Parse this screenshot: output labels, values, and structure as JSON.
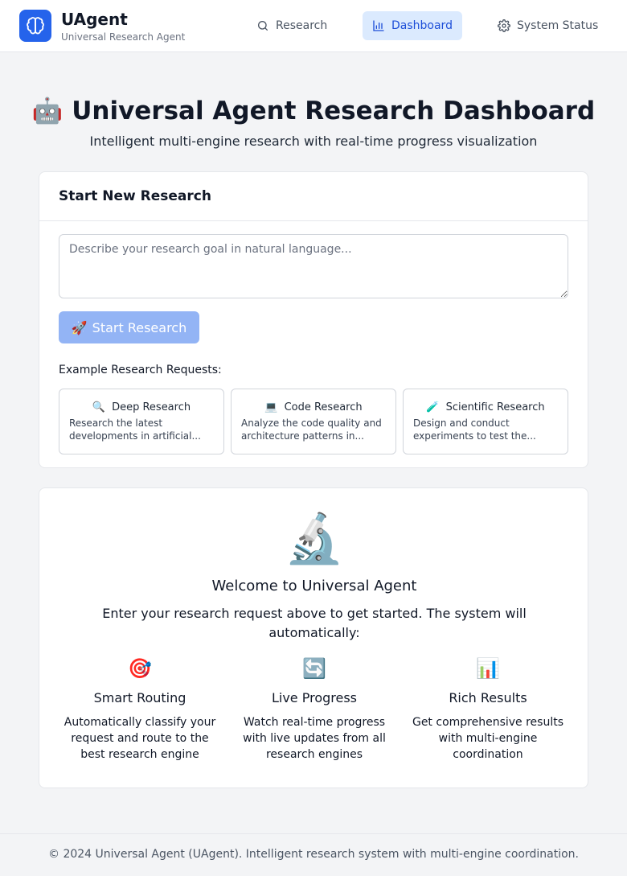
{
  "header": {
    "app_name": "UAgent",
    "app_subtitle": "Universal Research Agent",
    "logo_icon": "brain-icon",
    "nav": [
      {
        "label": "Research",
        "icon": "search-icon",
        "active": false
      },
      {
        "label": "Dashboard",
        "icon": "bar-chart-icon",
        "active": true
      },
      {
        "label": "System Status",
        "icon": "gear-icon",
        "active": false
      }
    ]
  },
  "page": {
    "title_emoji": "🤖",
    "title": "Universal Agent Research Dashboard",
    "subtitle": "Intelligent multi-engine research with real-time progress visualization"
  },
  "research_form": {
    "heading": "Start New Research",
    "goal_placeholder": "Describe your research goal in natural language...",
    "goal_value": "",
    "start_button_emoji": "🚀",
    "start_button_label": "Start Research",
    "examples_label": "Example Research Requests:",
    "examples": [
      {
        "emoji": "🔍",
        "title": "Deep Research",
        "description": "Research the latest developments in artificial..."
      },
      {
        "emoji": "💻",
        "title": "Code Research",
        "description": "Analyze the code quality and architecture patterns in..."
      },
      {
        "emoji": "🧪",
        "title": "Scientific Research",
        "description": "Design and conduct experiments to test the..."
      }
    ]
  },
  "welcome": {
    "emoji": "🔬",
    "title": "Welcome to Universal Agent",
    "text": "Enter your research request above to get started. The system will automatically:",
    "features": [
      {
        "emoji": "🎯",
        "title": "Smart Routing",
        "description": "Automatically classify your request and route to the best research engine"
      },
      {
        "emoji": "🔄",
        "title": "Live Progress",
        "description": "Watch real-time progress with live updates from all research engines"
      },
      {
        "emoji": "📊",
        "title": "Rich Results",
        "description": "Get comprehensive results with multi-engine coordination"
      }
    ]
  },
  "footer": {
    "text": "© 2024 Universal Agent (UAgent). Intelligent research system with multi-engine coordination."
  },
  "colors": {
    "brand": "#2563eb",
    "active_nav_bg": "#dbeafe",
    "button_disabled": "#93b4f5",
    "page_bg": "#f3f4f6"
  }
}
